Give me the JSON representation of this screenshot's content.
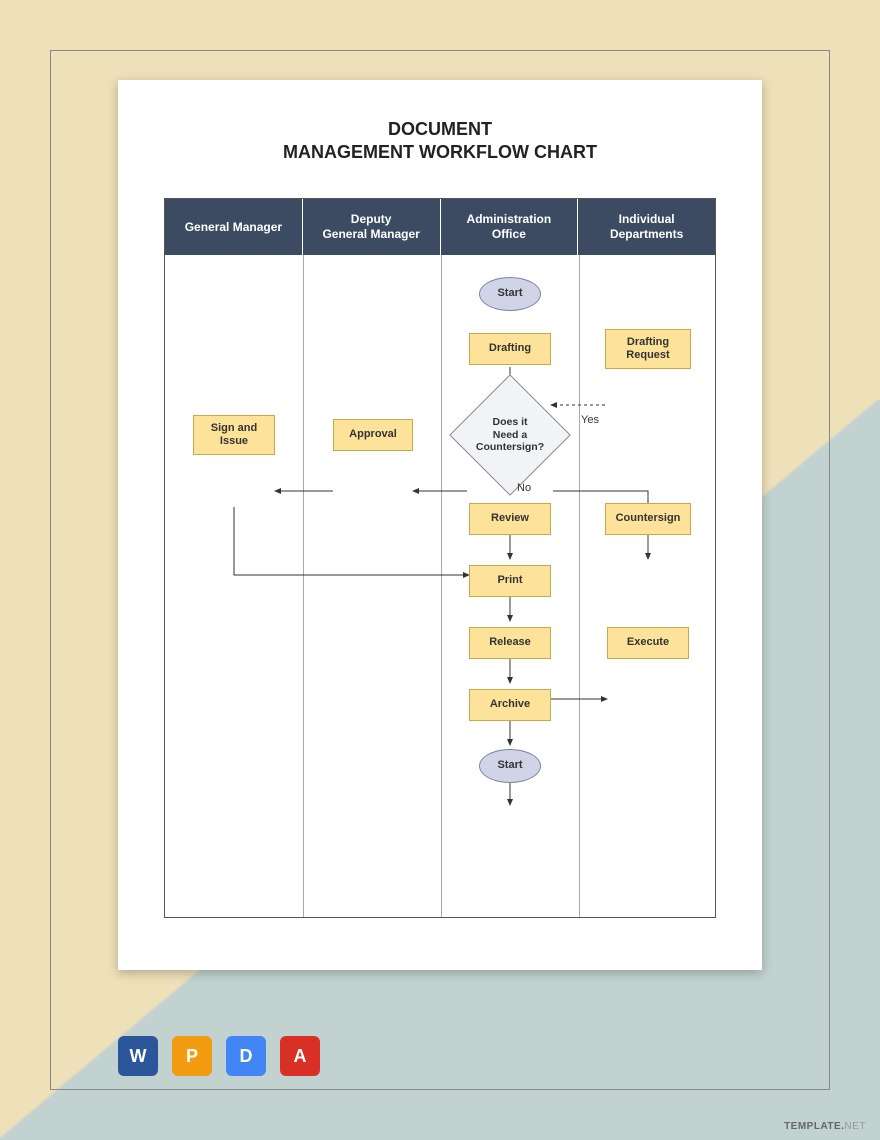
{
  "title_l1": "DOCUMENT",
  "title_l2": "MANAGEMENT WORKFLOW CHART",
  "columns": [
    "General Manager",
    "Deputy\nGeneral Manager",
    "Administration\nOffice",
    "Individual\nDepartments"
  ],
  "nodes": {
    "start": "Start",
    "drafting": "Drafting",
    "drafting_request": "Drafting\nRequest",
    "decision": "Does it\nNeed a\nCountersign?",
    "approval": "Approval",
    "sign_issue": "Sign and\nIssue",
    "review": "Review",
    "countersign": "Countersign",
    "print": "Print",
    "release": "Release",
    "execute": "Execute",
    "archive": "Archive",
    "end": "Start"
  },
  "labels": {
    "yes": "Yes",
    "no": "No"
  },
  "watermark_bold": "TEMPLATE.",
  "watermark_light": "NET",
  "icons": [
    "W",
    "P",
    "D",
    "A"
  ]
}
